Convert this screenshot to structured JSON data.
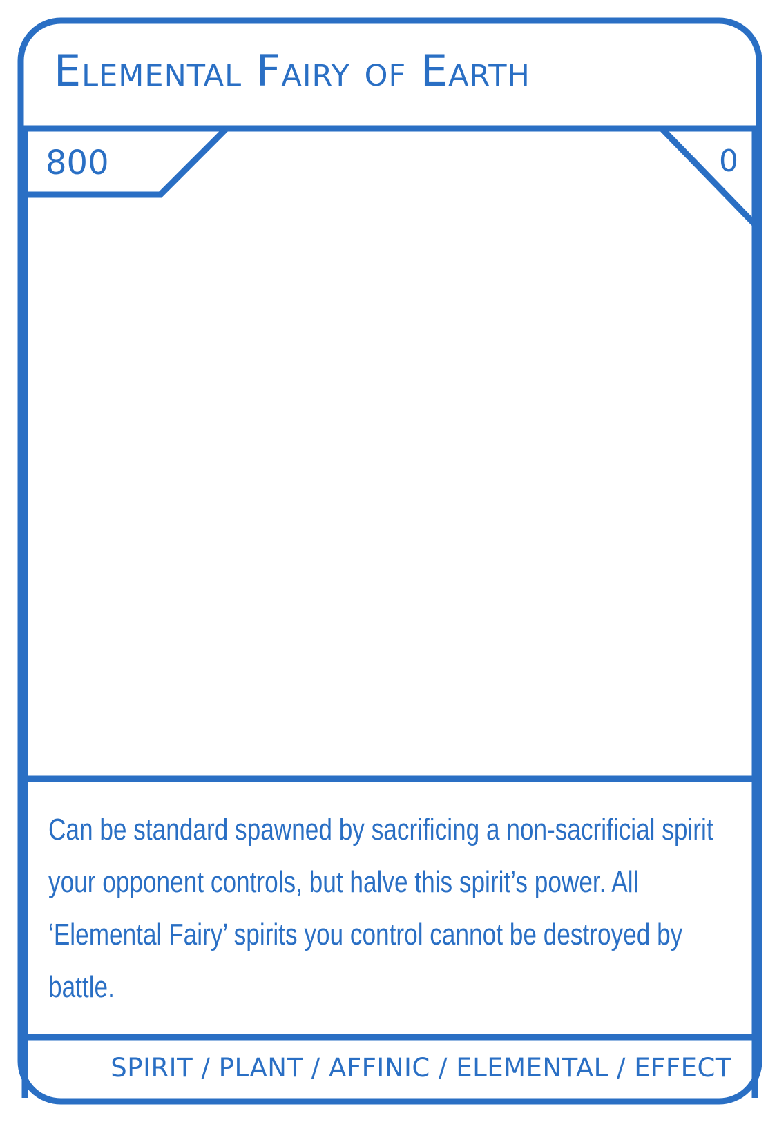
{
  "card": {
    "name": "Elemental Fairy of Earth",
    "power": "800",
    "cost": "0",
    "effect": "Can be standard spawned by sacrificing a non-sacrificial spirit your opponent controls, but halve this spirit’s power. All ‘Elemental Fairy’ spirits you control cannot be destroyed by battle.",
    "types": "SPIRIT / PLANT / AFFINIC / ELEMENTAL / EFFECT"
  },
  "colors": {
    "frame": "#2a6fc4",
    "background": "#ffffff"
  }
}
